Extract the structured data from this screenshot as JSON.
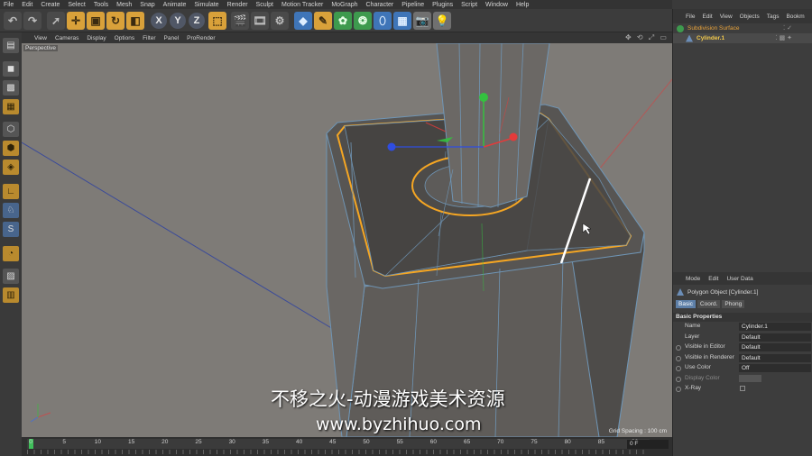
{
  "menubar": [
    "File",
    "Edit",
    "Create",
    "Select",
    "Tools",
    "Mesh",
    "Snap",
    "Animate",
    "Simulate",
    "Render",
    "Sculpt",
    "Motion Tracker",
    "MoGraph",
    "Character",
    "Pipeline",
    "Plugins",
    "Script",
    "Window",
    "Help"
  ],
  "toolbar": {
    "undo_icon": "undo-icon",
    "axis_x": "X",
    "axis_y": "Y",
    "axis_z": "Z"
  },
  "viewport_menu": [
    "View",
    "Cameras",
    "Display",
    "Options",
    "Filter",
    "Panel",
    "ProRender"
  ],
  "viewport": {
    "label": "Perspective",
    "grid_spacing": "Grid Spacing : 100 cm"
  },
  "timeline": {
    "frames": [
      "0",
      "5",
      "10",
      "15",
      "20",
      "25",
      "30",
      "35",
      "40",
      "45",
      "50",
      "55",
      "60",
      "65",
      "70",
      "75",
      "80",
      "85",
      "90"
    ],
    "current_frame": "0 F"
  },
  "object_manager": {
    "menu": [
      "File",
      "Edit",
      "View",
      "Objects",
      "Tags",
      "Bookm"
    ],
    "objects": [
      {
        "name": "Subdivision Surface",
        "color": "#e8a23a",
        "selected": false
      },
      {
        "name": "Cylinder.1",
        "color": "#f2c94c",
        "selected": true
      }
    ]
  },
  "attribute_manager": {
    "menu": [
      "Mode",
      "Edit",
      "User Data"
    ],
    "title": "Polygon Object [Cylinder.1]",
    "tabs": [
      "Basic",
      "Coord.",
      "Phong"
    ],
    "section": "Basic Properties",
    "rows": [
      {
        "label": "Name",
        "value": "Cylinder.1"
      },
      {
        "label": "Layer",
        "value": "Default"
      },
      {
        "label": "Visible in Editor",
        "value": "Default"
      },
      {
        "label": "Visible in Renderer",
        "value": "Default"
      },
      {
        "label": "Use Color",
        "value": "Off"
      },
      {
        "label": "Display Color",
        "value": ""
      },
      {
        "label": "X-Ray",
        "value": ""
      }
    ]
  },
  "watermark": {
    "line1": "不移之火-动漫游戏美术资源",
    "line2": "www.byzhihuo.com"
  },
  "colors": {
    "selection_edge": "#f5a623",
    "axis_x": "#e33b3b",
    "axis_y": "#34c13f",
    "axis_z": "#2f4de0",
    "viewport_bg": "#7e7b77"
  }
}
